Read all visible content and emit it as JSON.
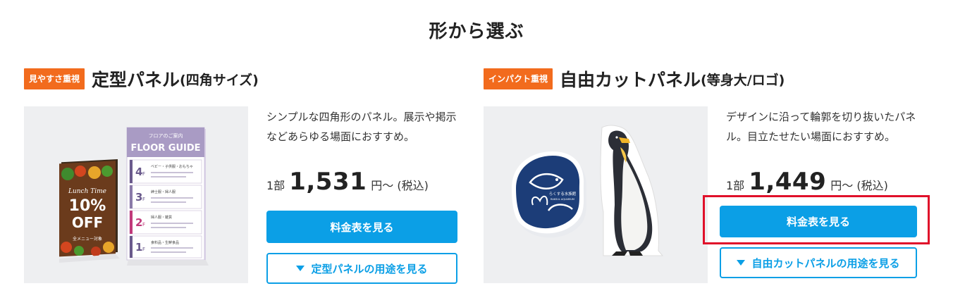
{
  "section": {
    "title": "形から選ぶ"
  },
  "cards": [
    {
      "badge": "見やすさ重視",
      "title": "定型パネル",
      "title_sub": "(四角サイズ)",
      "description": "シンプルな四角形のパネル。展示や掲示などあらゆる場面におすすめ。",
      "price_unit": "1部",
      "price_value": "1,531",
      "price_suffix": "円～ (税込)",
      "primary_button": "料金表を見る",
      "outline_button": "定型パネルの用途を見る",
      "image": {
        "floor_header": "フロアのご案内",
        "floor_title": "FLOOR GUIDE",
        "floors": [
          {
            "num": "4",
            "unit": "F",
            "name": "ベビー・子供服・おもちゃ"
          },
          {
            "num": "3",
            "unit": "F",
            "name": "紳士服・婦人服"
          },
          {
            "num": "2",
            "unit": "F",
            "name": "婦人服・雑貨"
          },
          {
            "num": "1",
            "unit": "F",
            "name": "食料品・生鮮食品"
          }
        ],
        "lunch_line1": "Lunch Time",
        "lunch_line2": "10%",
        "lunch_line3": "OFF",
        "lunch_line4": "全メニュー対象"
      }
    },
    {
      "badge": "インパクト重視",
      "title": "自由カットパネル",
      "title_sub": "(等身大/ロゴ)",
      "description": "デザインに沿って輪郭を切り抜いたパネル。目立たせたい場面におすすめ。",
      "price_unit": "1部",
      "price_value": "1,449",
      "price_suffix": "円～ (税込)",
      "primary_button": "料金表を見る",
      "outline_button": "自由カットパネルの用途を見る",
      "image": {
        "logo_text": "らくする水族館",
        "logo_sub": "RAKSUL AQUARIUM"
      }
    }
  ],
  "colors": {
    "badge": "#f26b1d",
    "primary": "#0b9fe6",
    "highlight": "#e0102a",
    "image_bg": "#eeeff1"
  }
}
